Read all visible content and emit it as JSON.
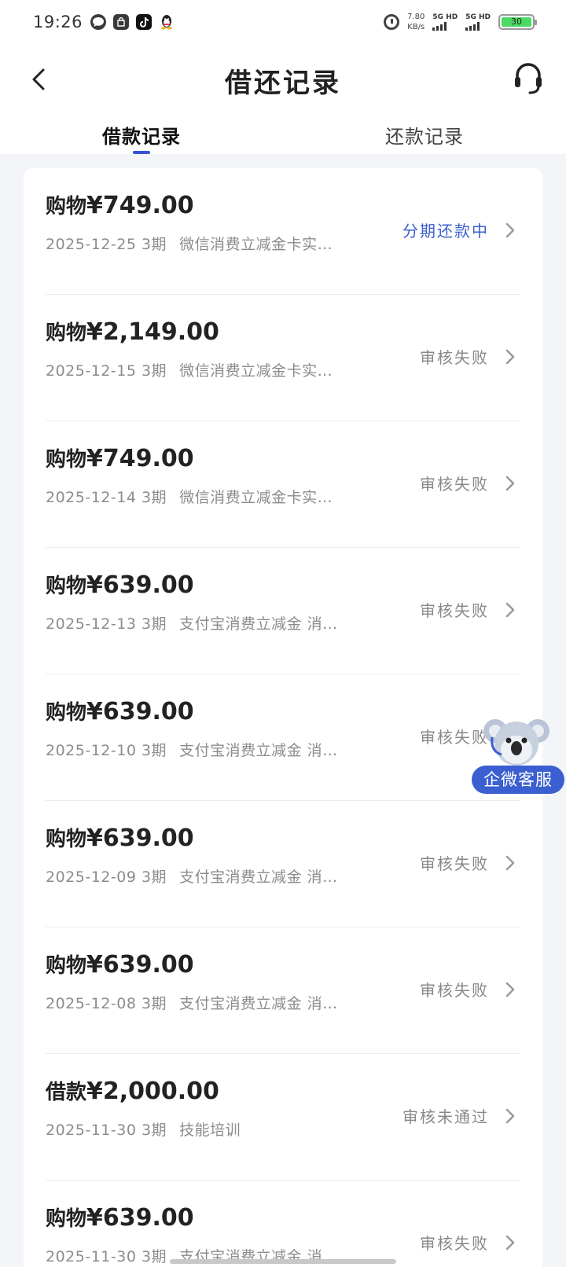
{
  "status_bar": {
    "time": "19:26",
    "net_speed_value": "7.80",
    "net_speed_unit": "KB/s",
    "sim1": "5G HD",
    "sim2": "5G HD",
    "battery": "30",
    "battery_color": "#4cd964"
  },
  "header": {
    "title": "借还记录"
  },
  "tabs": [
    {
      "label": "借款记录",
      "active": true
    },
    {
      "label": "还款记录",
      "active": false
    }
  ],
  "colors": {
    "accent": "#3b5fd0",
    "status_gray": "#888888"
  },
  "records": [
    {
      "kind": "购物",
      "amount": "¥749.00",
      "date": "2025-12-25",
      "term": "3期",
      "desc": "微信消费立减金卡实…",
      "status": "分期还款中",
      "status_color": "blue"
    },
    {
      "kind": "购物",
      "amount": "¥2,149.00",
      "date": "2025-12-15",
      "term": "3期",
      "desc": "微信消费立减金卡实…",
      "status": "审核失败",
      "status_color": "gray"
    },
    {
      "kind": "购物",
      "amount": "¥749.00",
      "date": "2025-12-14",
      "term": "3期",
      "desc": "微信消费立减金卡实…",
      "status": "审核失败",
      "status_color": "gray"
    },
    {
      "kind": "购物",
      "amount": "¥639.00",
      "date": "2025-12-13",
      "term": "3期",
      "desc": "支付宝消费立减金 消…",
      "status": "审核失败",
      "status_color": "gray"
    },
    {
      "kind": "购物",
      "amount": "¥639.00",
      "date": "2025-12-10",
      "term": "3期",
      "desc": "支付宝消费立减金 消…",
      "status": "审核失败",
      "status_color": "gray"
    },
    {
      "kind": "购物",
      "amount": "¥639.00",
      "date": "2025-12-09",
      "term": "3期",
      "desc": "支付宝消费立减金 消…",
      "status": "审核失败",
      "status_color": "gray"
    },
    {
      "kind": "购物",
      "amount": "¥639.00",
      "date": "2025-12-08",
      "term": "3期",
      "desc": "支付宝消费立减金 消…",
      "status": "审核失败",
      "status_color": "gray"
    },
    {
      "kind": "借款",
      "amount": "¥2,000.00",
      "date": "2025-11-30",
      "term": "3期",
      "desc": "技能培训",
      "status": "审核未通过",
      "status_color": "gray"
    },
    {
      "kind": "购物",
      "amount": "¥639.00",
      "date": "2025-11-30",
      "term": "3期",
      "desc": "支付宝消费立减金 消…",
      "status": "审核失败",
      "status_color": "gray"
    }
  ],
  "floating_service": {
    "label": "企微客服",
    "icon": "koala-icon"
  }
}
